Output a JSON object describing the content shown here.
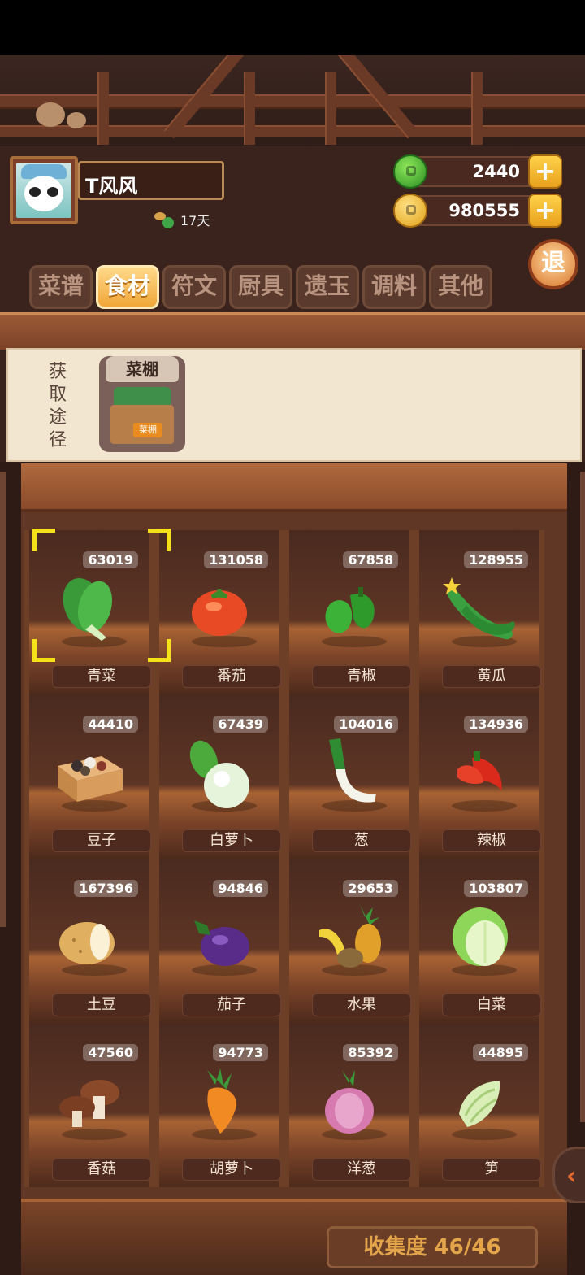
{
  "player": {
    "name": "T风风",
    "days": "17天"
  },
  "currency": {
    "jade": "2440",
    "coins": "980555",
    "plus": "+"
  },
  "exit_label": "退",
  "tabs": [
    {
      "label": "菜谱",
      "active": false
    },
    {
      "label": "食材",
      "active": true
    },
    {
      "label": "符文",
      "active": false
    },
    {
      "label": "厨具",
      "active": false
    },
    {
      "label": "遗玉",
      "active": false
    },
    {
      "label": "调料",
      "active": false
    },
    {
      "label": "其他",
      "active": false
    }
  ],
  "source": {
    "label": "获取途径",
    "card_title": "菜棚",
    "stall_sign": "菜棚"
  },
  "ingredients": [
    {
      "name": "青菜",
      "count": "63019",
      "icon": "bok-choy-icon"
    },
    {
      "name": "番茄",
      "count": "131058",
      "icon": "tomato-icon"
    },
    {
      "name": "青椒",
      "count": "67858",
      "icon": "green-pepper-icon"
    },
    {
      "name": "黄瓜",
      "count": "128955",
      "icon": "cucumber-icon"
    },
    {
      "name": "豆子",
      "count": "44410",
      "icon": "beans-box-icon"
    },
    {
      "name": "白萝卜",
      "count": "67439",
      "icon": "white-radish-icon"
    },
    {
      "name": "葱",
      "count": "104016",
      "icon": "scallion-icon"
    },
    {
      "name": "辣椒",
      "count": "134936",
      "icon": "chili-icon"
    },
    {
      "name": "土豆",
      "count": "167396",
      "icon": "potato-icon"
    },
    {
      "name": "茄子",
      "count": "94846",
      "icon": "eggplant-icon"
    },
    {
      "name": "水果",
      "count": "29653",
      "icon": "fruit-icon"
    },
    {
      "name": "白菜",
      "count": "103807",
      "icon": "napa-cabbage-icon"
    },
    {
      "name": "香菇",
      "count": "47560",
      "icon": "mushroom-icon"
    },
    {
      "name": "胡萝卜",
      "count": "94773",
      "icon": "carrot-icon"
    },
    {
      "name": "洋葱",
      "count": "85392",
      "icon": "onion-icon"
    },
    {
      "name": "笋",
      "count": "44895",
      "icon": "bamboo-shoot-icon"
    }
  ],
  "collection": "收集度 46/46"
}
